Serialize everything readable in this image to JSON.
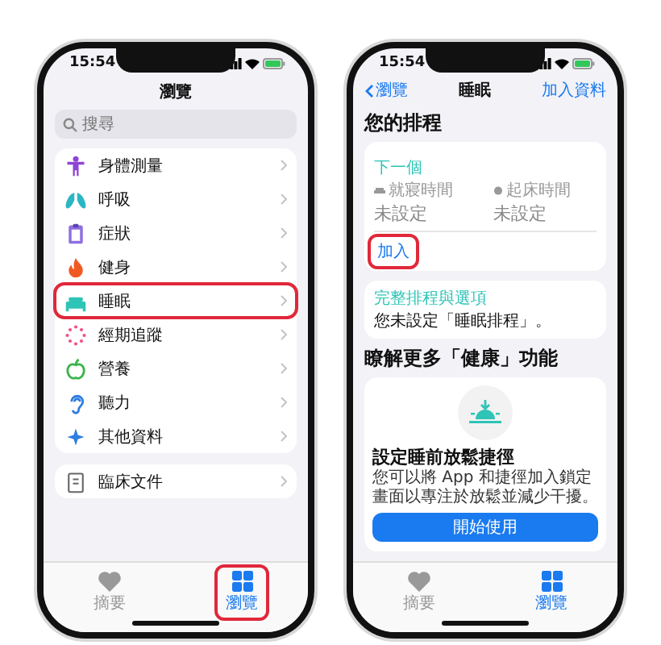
{
  "phones": [
    {
      "kind": "browse",
      "time": "15:54",
      "title": "瀏覽",
      "search": {
        "placeholder": "搜尋"
      },
      "categories": [
        {
          "label": "身體測量",
          "highlighted": false
        },
        {
          "label": "呼吸",
          "highlighted": false
        },
        {
          "label": "症狀",
          "highlighted": false
        },
        {
          "label": "健身",
          "highlighted": false
        },
        {
          "label": "睡眠",
          "highlighted": true
        },
        {
          "label": "經期追蹤",
          "highlighted": false
        },
        {
          "label": "營養",
          "highlighted": false
        },
        {
          "label": "聽力",
          "highlighted": false
        },
        {
          "label": "其他資料",
          "highlighted": false
        }
      ],
      "documents": [
        {
          "label": "臨床文件",
          "highlighted": false
        }
      ],
      "tabs": [
        {
          "label": "摘要",
          "selected": false,
          "highlighted": false
        },
        {
          "label": "瀏覽",
          "selected": true,
          "highlighted": true
        }
      ]
    },
    {
      "kind": "sleep",
      "time": "15:54",
      "back": "瀏覽",
      "title": "睡眠",
      "action": "加入資料",
      "schedule": {
        "heading": "您的排程",
        "next": "下一個",
        "slots": [
          {
            "label": "就寢時間",
            "value": "未設定"
          },
          {
            "label": "起床時間",
            "value": "未設定"
          }
        ],
        "add": {
          "label": "加入",
          "highlighted": true
        }
      },
      "options": {
        "title": "完整排程與選項",
        "text": "您未設定「睡眠排程」。"
      },
      "learn": {
        "heading": "瞭解更多「健康」功能",
        "title": "設定睡前放鬆捷徑",
        "text": "您可以將 App 和捷徑加入鎖定畫面以專注於放鬆並減少干擾。",
        "button": "開始使用"
      },
      "tabs": [
        {
          "label": "摘要",
          "selected": false,
          "highlighted": false
        },
        {
          "label": "瀏覽",
          "selected": true,
          "highlighted": false
        }
      ]
    }
  ]
}
